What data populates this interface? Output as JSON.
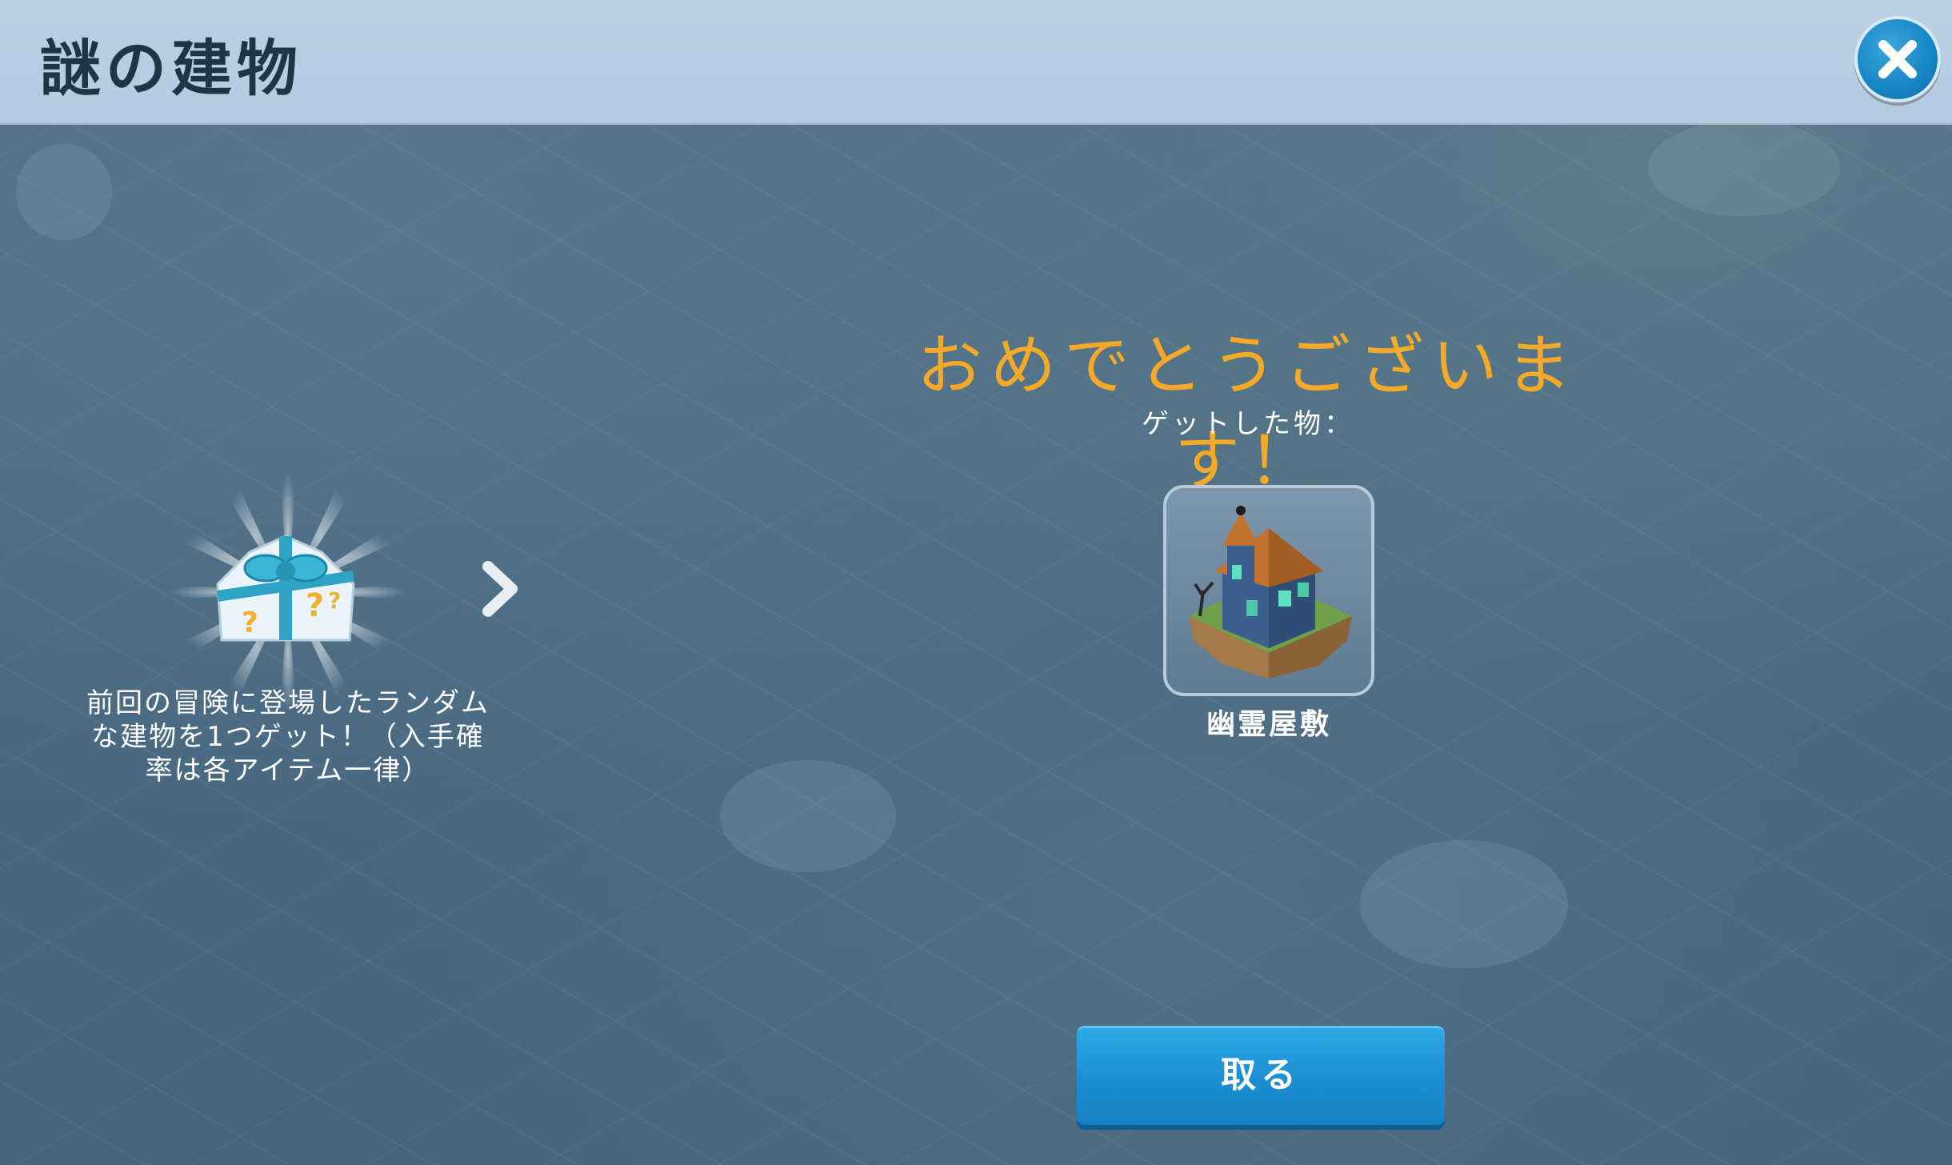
{
  "header": {
    "title": "謎の建物"
  },
  "left_panel": {
    "description": "前回の冒険に登場したランダムな建物を1つゲット！（入手確率は各アイテム一律）"
  },
  "right_panel": {
    "congrats": "おめでとうございます！",
    "got_label": "ゲットした物：",
    "item_name": "幽霊屋敷"
  },
  "actions": {
    "take_label": "取る"
  },
  "colors": {
    "accent": "#f4a928",
    "header_bg": "#b5cae0",
    "button": "#1b8ed2"
  },
  "icons": {
    "close": "close-icon",
    "arrow": "chevron-right-icon",
    "mystery_box": "gift-box-icon",
    "item": "haunted-house-icon"
  }
}
